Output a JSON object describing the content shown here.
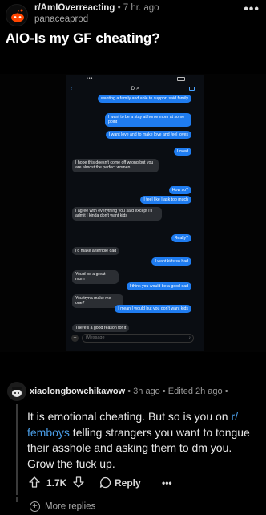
{
  "post": {
    "subreddit": "r/AmIOverreacting",
    "time": "7 hr. ago",
    "author": "panaceaprod",
    "title": "AIO-Is my GF cheating?",
    "overflow": "•••"
  },
  "screenshot": {
    "contact": "D >",
    "messages": [
      {
        "side": "out",
        "text": "wanting a family and able to support said family"
      },
      {
        "side": "out",
        "text": "I want to be a stay at home mom at some point"
      },
      {
        "side": "out",
        "text": "I want love and to make love and feel loves"
      },
      {
        "side": "out",
        "text": "Loved"
      },
      {
        "side": "in",
        "text": "I hope this doesn't come off wrong but you are almost the perfect women"
      },
      {
        "side": "out",
        "text": "How so?"
      },
      {
        "side": "out",
        "text": "I feel like I ask too much"
      },
      {
        "side": "in",
        "text": "I agree with everything you said except I'll admit I kinda don't want kids"
      },
      {
        "side": "out",
        "text": "Really?"
      },
      {
        "side": "in",
        "text": "I'd make a terrible dad"
      },
      {
        "side": "out",
        "text": "I want kids so bad"
      },
      {
        "side": "in",
        "text": "You'd be a great mom"
      },
      {
        "side": "out",
        "text": "I think you would be a good dad"
      },
      {
        "side": "in",
        "text": "You tryna make me one?"
      },
      {
        "side": "out",
        "text": "I mean I would but you don't want kids"
      },
      {
        "side": "in",
        "text": "There's a good reason for it"
      }
    ],
    "compose_placeholder": "iMessage"
  },
  "comment": {
    "username": "xiaolongbowchikawow",
    "time": "• 3h ago • Edited 2h ago •",
    "body_pre": "It is emotional cheating. But so is you on ",
    "body_link": "r/ femboys",
    "body_post": " telling strangers you want to tongue their asshole and asking them to dm you. Grow the fuck up.",
    "votes": "1.7K",
    "reply_label": "Reply",
    "more_label": "•••",
    "more_replies": "More replies"
  },
  "colors": {
    "background": "#000000",
    "link": "#4a9de6",
    "imessage_blue": "#1f7cf0"
  }
}
